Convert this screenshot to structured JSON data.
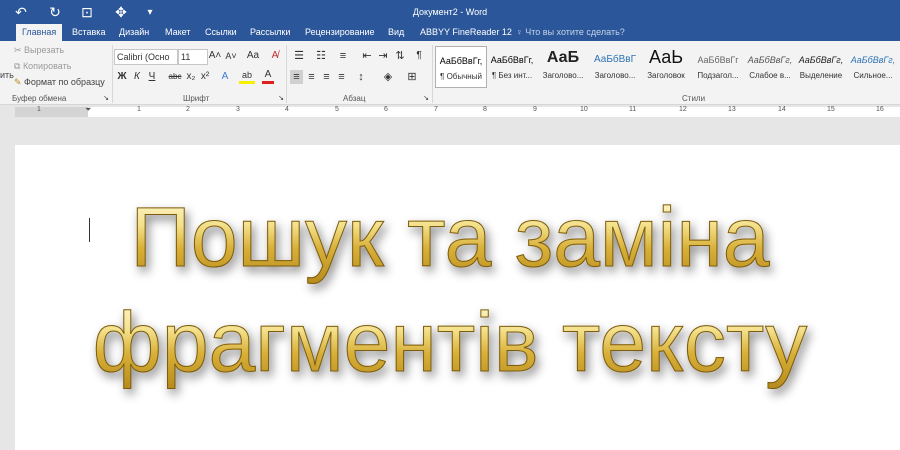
{
  "app": {
    "window_title": "Документ2 - Word",
    "quick_access": [
      {
        "name": "undo-icon",
        "glyph": "↶"
      },
      {
        "name": "redo-icon",
        "glyph": "↻"
      },
      {
        "name": "print-preview-icon",
        "glyph": "⊡"
      },
      {
        "name": "touch-mode-icon",
        "glyph": "✥"
      },
      {
        "name": "customize-qat-icon",
        "glyph": "▾"
      }
    ]
  },
  "tabs": [
    "Главная",
    "Вставка",
    "Дизайн",
    "Макет",
    "Ссылки",
    "Рассылки",
    "Рецензирование",
    "Вид",
    "ABBYY FineReader 12"
  ],
  "active_tab": "Главная",
  "tell_me": {
    "icon": "lightbulb-icon",
    "placeholder": "Что вы хотите сделать?"
  },
  "ribbon": {
    "clipboard": {
      "paste_label": "ить",
      "cut": "Вырезать",
      "copy": "Копировать",
      "format_painter": "Формат по образцу",
      "group_label": "Буфер обмена"
    },
    "font": {
      "font_name": "Calibri (Осно",
      "font_size": "11",
      "grow": "A˄",
      "shrink": "A˅",
      "change_case": "Aa",
      "clear_format": "A̸",
      "bold": "Ж",
      "italic": "К",
      "underline": "Ч",
      "strikethrough": "abc",
      "subscript": "x₂",
      "superscript": "x²",
      "text_effects": "A",
      "highlight": "ab",
      "font_color": "A",
      "group_label": "Шрифт"
    },
    "paragraph": {
      "group_label": "Абзац",
      "show_marks": "¶"
    },
    "styles": {
      "group_label": "Стили",
      "items": [
        {
          "sample": "АаБбВвГг,",
          "name": "¶ Обычный",
          "selected": true
        },
        {
          "sample": "АаБбВвГг,",
          "name": "¶ Без инт...",
          "selected": false
        },
        {
          "sample": "АаБ",
          "name": "Заголово...",
          "selected": false
        },
        {
          "sample": "АаБбВвГ",
          "name": "Заголово...",
          "selected": false
        },
        {
          "sample": "АаЬ",
          "name": "Заголовок",
          "selected": false
        },
        {
          "sample": "АаБбВвГг",
          "name": "Подзагол...",
          "selected": false
        },
        {
          "sample": "АаБбВвГг,",
          "name": "Слабое в...",
          "selected": false
        },
        {
          "sample": "АаБбВвГг,",
          "name": "Выделение",
          "selected": false
        },
        {
          "sample": "АаБбВвГг,",
          "name": "Сильное...",
          "selected": false
        }
      ]
    }
  },
  "ruler": {
    "numbers": [
      "1",
      "1",
      "2",
      "3",
      "4",
      "5",
      "6",
      "7",
      "8",
      "9",
      "10",
      "11",
      "12",
      "13",
      "14",
      "15",
      "16"
    ]
  },
  "document": {
    "line1": "Пошук та заміна",
    "line2": "фрагментів тексту"
  },
  "colors": {
    "title_bar": "#2b579a",
    "ribbon_bg": "#f3f3f3",
    "wordart_gold": "#d8b038",
    "font_color_bar": "#e0201c",
    "highlight_bar": "#f6f000"
  }
}
